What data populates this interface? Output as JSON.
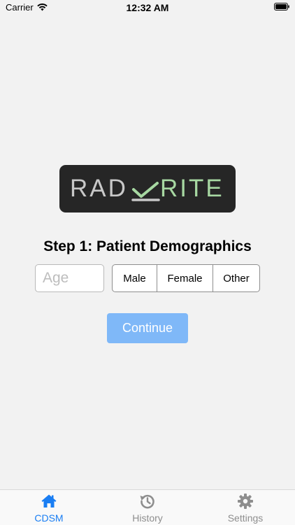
{
  "status_bar": {
    "carrier": "Carrier",
    "time": "12:32 AM"
  },
  "logo": {
    "left_text": "RAD",
    "right_text": "RITE"
  },
  "step": {
    "title": "Step 1: Patient Demographics"
  },
  "age_field": {
    "value": "",
    "placeholder": "Age"
  },
  "gender": {
    "options": [
      "Male",
      "Female",
      "Other"
    ]
  },
  "continue_button": {
    "label": "Continue"
  },
  "tabs": [
    {
      "label": "CDSM",
      "icon": "home-icon"
    },
    {
      "label": "History",
      "icon": "history-icon"
    },
    {
      "label": "Settings",
      "icon": "gear-icon"
    }
  ],
  "colors": {
    "accent": "#1a7ef3",
    "continue_bg": "#7fb8f8",
    "logo_bg": "#262626",
    "logo_green": "#a7d8a2",
    "inactive_tab": "#8e8e8e"
  }
}
